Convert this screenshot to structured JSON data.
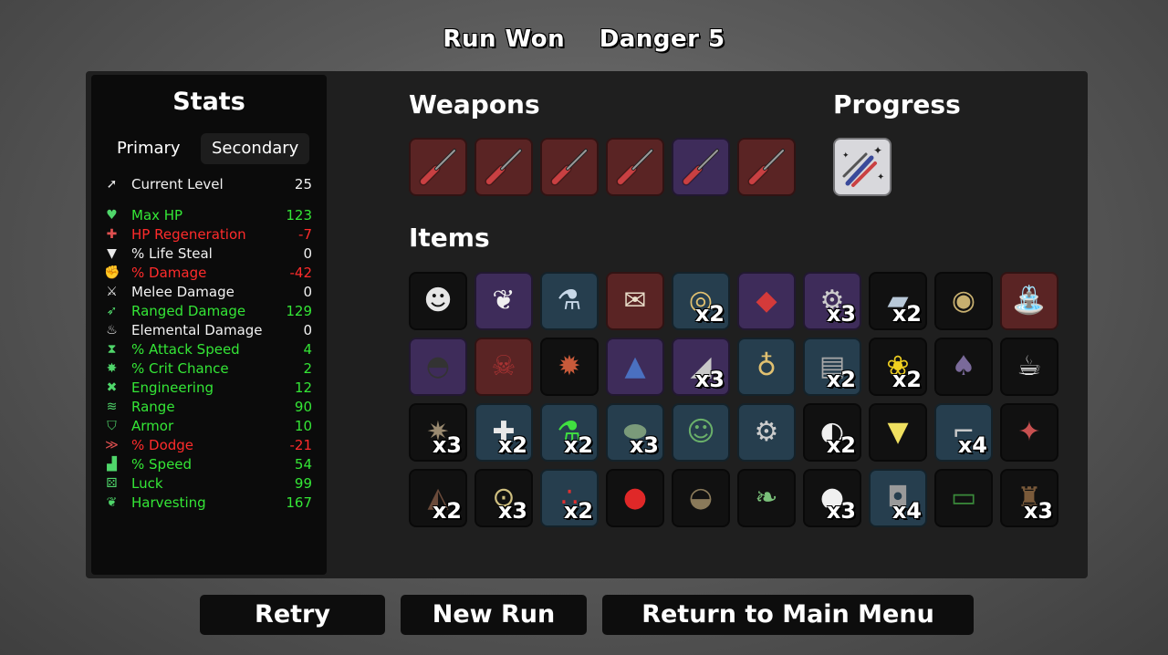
{
  "header": {
    "status": "Run Won",
    "danger": "Danger 5"
  },
  "stats": {
    "title": "Stats",
    "tabs": {
      "primary": "Primary",
      "secondary": "Secondary"
    },
    "rows": [
      {
        "name": "Current Level",
        "value": "25",
        "color": "white",
        "icon": "level-up-icon",
        "glyph": "➚"
      },
      {
        "name": "Max HP",
        "value": "123",
        "color": "green",
        "icon": "heart-icon",
        "glyph": "♥"
      },
      {
        "name": "HP Regeneration",
        "value": "-7",
        "color": "red",
        "icon": "heart-plus-icon",
        "glyph": "✚"
      },
      {
        "name": "% Life Steal",
        "value": "0",
        "color": "white",
        "icon": "fangs-icon",
        "glyph": "▼"
      },
      {
        "name": "% Damage",
        "value": "-42",
        "color": "red",
        "icon": "muscle-icon",
        "glyph": "✊"
      },
      {
        "name": "Melee Damage",
        "value": "0",
        "color": "white",
        "icon": "sword-icon",
        "glyph": "⚔"
      },
      {
        "name": "Ranged Damage",
        "value": "129",
        "color": "green",
        "icon": "bow-icon",
        "glyph": "➶"
      },
      {
        "name": "Elemental Damage",
        "value": "0",
        "color": "white",
        "icon": "flame-icon",
        "glyph": "♨"
      },
      {
        "name": "% Attack Speed",
        "value": "4",
        "color": "green",
        "icon": "hourglass-icon",
        "glyph": "⧗"
      },
      {
        "name": "% Crit Chance",
        "value": "2",
        "color": "green",
        "icon": "crit-burst-icon",
        "glyph": "✸"
      },
      {
        "name": "Engineering",
        "value": "12",
        "color": "green",
        "icon": "wrench-icon",
        "glyph": "✖"
      },
      {
        "name": "Range",
        "value": "90",
        "color": "green",
        "icon": "range-waves-icon",
        "glyph": "≋"
      },
      {
        "name": "Armor",
        "value": "10",
        "color": "green",
        "icon": "shield-icon",
        "glyph": "⛉"
      },
      {
        "name": "% Dodge",
        "value": "-21",
        "color": "red",
        "icon": "dodge-wind-icon",
        "glyph": "≫"
      },
      {
        "name": "% Speed",
        "value": "54",
        "color": "green",
        "icon": "boot-icon",
        "glyph": "▟"
      },
      {
        "name": "Luck",
        "value": "99",
        "color": "green",
        "icon": "dice-icon",
        "glyph": "⚄"
      },
      {
        "name": "Harvesting",
        "value": "167",
        "color": "green",
        "icon": "wheat-icon",
        "glyph": "❦"
      }
    ]
  },
  "weapons": {
    "title": "Weapons",
    "slots": [
      {
        "tier": "red",
        "icon": "screwdriver-icon"
      },
      {
        "tier": "red",
        "icon": "screwdriver-icon"
      },
      {
        "tier": "red",
        "icon": "screwdriver-icon"
      },
      {
        "tier": "red",
        "icon": "screwdriver-icon"
      },
      {
        "tier": "purple",
        "icon": "screwdriver-icon"
      },
      {
        "tier": "red",
        "icon": "screwdriver-icon"
      }
    ]
  },
  "progress": {
    "title": "Progress",
    "slots": [
      {
        "tier": "light",
        "icon": "tools-sparkle-icon"
      }
    ]
  },
  "items": {
    "title": "Items",
    "slots": [
      {
        "tier": "dark",
        "icon": "bearded-mask-icon",
        "glyph": "☻",
        "qty": ""
      },
      {
        "tier": "purple",
        "icon": "wings-icon",
        "glyph": "❦",
        "qty": ""
      },
      {
        "tier": "blue",
        "icon": "potion-flask-icon",
        "glyph": "⚗",
        "qty": ""
      },
      {
        "tier": "red",
        "icon": "scroll-icon",
        "glyph": "✉",
        "qty": ""
      },
      {
        "tier": "blue",
        "icon": "ring-pendant-icon",
        "glyph": "◎",
        "qty": "x2"
      },
      {
        "tier": "purple",
        "icon": "bandana-icon",
        "glyph": "◆",
        "qty": ""
      },
      {
        "tier": "purple",
        "icon": "robot-arm-icon",
        "glyph": "⚙",
        "qty": "x3"
      },
      {
        "tier": "dark",
        "icon": "metal-plate-icon",
        "glyph": "▰",
        "qty": "x2"
      },
      {
        "tier": "dark",
        "icon": "helmet-icon",
        "glyph": "◉",
        "qty": ""
      },
      {
        "tier": "red",
        "icon": "sprinkler-icon",
        "glyph": "⛲",
        "qty": ""
      },
      {
        "tier": "purple",
        "icon": "bowler-hat-icon",
        "glyph": "◓",
        "qty": ""
      },
      {
        "tier": "red",
        "icon": "jolly-roger-icon",
        "glyph": "☠",
        "qty": ""
      },
      {
        "tier": "dark",
        "icon": "dynamite-icon",
        "glyph": "✹",
        "qty": ""
      },
      {
        "tier": "purple",
        "icon": "wizard-hat-icon",
        "glyph": "▲",
        "qty": ""
      },
      {
        "tier": "purple",
        "icon": "metal-shard-icon",
        "glyph": "◢",
        "qty": "x3"
      },
      {
        "tier": "blue",
        "icon": "amulet-icon",
        "glyph": "♁",
        "qty": ""
      },
      {
        "tier": "blue",
        "icon": "armor-plates-icon",
        "glyph": "▤",
        "qty": "x2"
      },
      {
        "tier": "dark",
        "icon": "rubber-duck-icon",
        "glyph": "❀",
        "qty": "x2"
      },
      {
        "tier": "dark",
        "icon": "mushroom-icon",
        "glyph": "♠",
        "qty": ""
      },
      {
        "tier": "dark",
        "icon": "coffee-cup-icon",
        "glyph": "☕",
        "qty": ""
      },
      {
        "tier": "dark",
        "icon": "hedgehog-icon",
        "glyph": "✷",
        "qty": "x3"
      },
      {
        "tier": "blue",
        "icon": "medkit-icon",
        "glyph": "✚",
        "qty": "x2"
      },
      {
        "tier": "blue",
        "icon": "green-potion-icon",
        "glyph": "⚗",
        "qty": "x2"
      },
      {
        "tier": "blue",
        "icon": "capsule-icon",
        "glyph": "⬬",
        "qty": "x3"
      },
      {
        "tier": "blue",
        "icon": "frog-icon",
        "glyph": "☺",
        "qty": ""
      },
      {
        "tier": "blue",
        "icon": "gear-icon",
        "glyph": "⚙",
        "qty": ""
      },
      {
        "tier": "dark",
        "icon": "claw-icon",
        "glyph": "◐",
        "qty": "x2"
      },
      {
        "tier": "dark",
        "icon": "lemonade-cup-icon",
        "glyph": "▼",
        "qty": ""
      },
      {
        "tier": "blue",
        "icon": "robot-arm-lamp-icon",
        "glyph": "⌐",
        "qty": "x4"
      },
      {
        "tier": "dark",
        "icon": "meat-skewer-icon",
        "glyph": "✦",
        "qty": ""
      },
      {
        "tier": "dark",
        "icon": "cake-slice-icon",
        "glyph": "◭",
        "qty": "x2"
      },
      {
        "tier": "dark",
        "icon": "turret-bot-icon",
        "glyph": "⊙",
        "qty": "x3"
      },
      {
        "tier": "blue",
        "icon": "spider-eggs-icon",
        "glyph": "∴",
        "qty": "x2"
      },
      {
        "tier": "dark",
        "icon": "boxing-glove-icon",
        "glyph": "●",
        "qty": ""
      },
      {
        "tier": "dark",
        "icon": "hood-icon",
        "glyph": "◒",
        "qty": ""
      },
      {
        "tier": "dark",
        "icon": "herb-sack-icon",
        "glyph": "❧",
        "qty": ""
      },
      {
        "tier": "dark",
        "icon": "snowball-icon",
        "glyph": "●",
        "qty": "x3"
      },
      {
        "tier": "blue",
        "icon": "backpack-robot-icon",
        "glyph": "◘",
        "qty": "x4"
      },
      {
        "tier": "dark",
        "icon": "banknote-icon",
        "glyph": "▭",
        "qty": ""
      },
      {
        "tier": "dark",
        "icon": "coin-bag-icon",
        "glyph": "♜",
        "qty": "x3"
      }
    ]
  },
  "buttons": {
    "retry": "Retry",
    "new_run": "New Run",
    "main_menu": "Return to Main Menu"
  }
}
